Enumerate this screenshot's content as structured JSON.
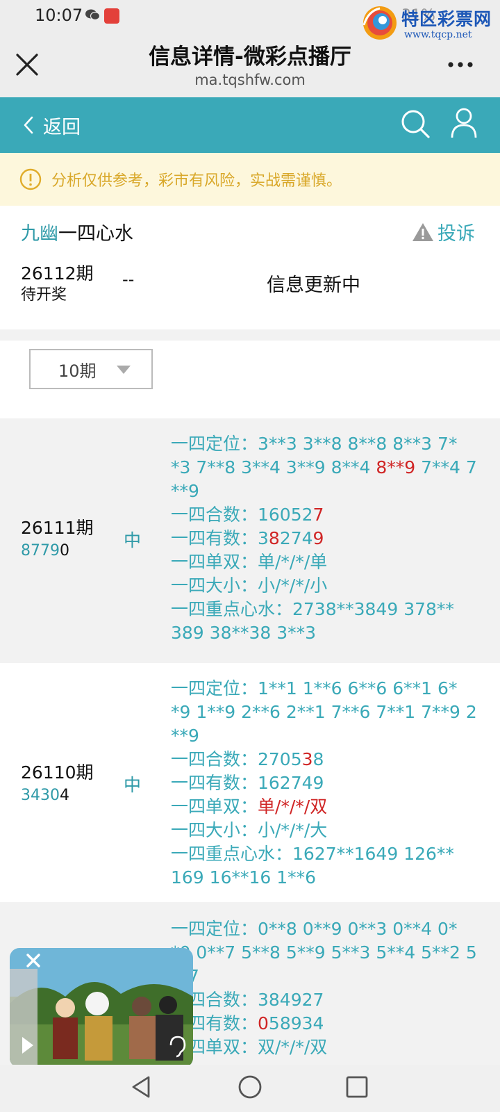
{
  "status": {
    "time": "10:07",
    "battery": "31%"
  },
  "watermark": {
    "name": "特区彩票网",
    "url": "www.tqcp.net"
  },
  "titlebar": {
    "title": "信息详情-微彩点播厅",
    "url": "ma.tqshfw.com"
  },
  "navbar": {
    "back_label": "返回"
  },
  "warning": {
    "text": "分析仅供参考，彩市有风险，实战需谨慎。"
  },
  "info": {
    "author": "九幽",
    "topic": "一四心水",
    "report_label": "投诉",
    "period": "26112期",
    "status": "待开奖",
    "dash": "--",
    "update_text": "信息更新中"
  },
  "filter": {
    "selected": "10期"
  },
  "records": [
    {
      "period": "26111期",
      "num_prefix": "8779",
      "num_last": "0",
      "hit": "中",
      "lines": [
        {
          "segs": [
            {
              "t": "一四定位：3**3 3**8 8**8 8**3 7*"
            }
          ]
        },
        {
          "segs": [
            {
              "t": "*3 7**8 3**4 3**9 8**4 "
            },
            {
              "t": "8**9",
              "r": true
            },
            {
              "t": " 7**4 7"
            }
          ]
        },
        {
          "segs": [
            {
              "t": "**9"
            }
          ]
        },
        {
          "segs": [
            {
              "t": "一四合数：16052"
            },
            {
              "t": "7",
              "r": true
            }
          ]
        },
        {
          "segs": [
            {
              "t": "一四有数：3"
            },
            {
              "t": "8",
              "r": true
            },
            {
              "t": "274"
            },
            {
              "t": "9",
              "r": true
            }
          ]
        },
        {
          "segs": [
            {
              "t": "一四单双：单/*/*/单"
            }
          ]
        },
        {
          "segs": [
            {
              "t": "一四大小：小/*/*/小"
            }
          ]
        },
        {
          "segs": [
            {
              "t": "一四重点心水：2738**3849 378**"
            }
          ]
        },
        {
          "segs": [
            {
              "t": "389 38**38 3**3"
            }
          ]
        }
      ]
    },
    {
      "period": "26110期",
      "num_prefix": "3430",
      "num_last": "4",
      "hit": "中",
      "lines": [
        {
          "segs": [
            {
              "t": "一四定位：1**1 1**6 6**6 6**1 6*"
            }
          ]
        },
        {
          "segs": [
            {
              "t": "*9 1**9 2**6 2**1 7**6 7**1 7**9 2"
            }
          ]
        },
        {
          "segs": [
            {
              "t": "**9"
            }
          ]
        },
        {
          "segs": [
            {
              "t": "一四合数：2705"
            },
            {
              "t": "3",
              "r": true
            },
            {
              "t": "8"
            }
          ]
        },
        {
          "segs": [
            {
              "t": "一四有数：162749"
            }
          ]
        },
        {
          "segs": [
            {
              "t": "一四单双："
            },
            {
              "t": "单/*/*/双",
              "r": true
            }
          ]
        },
        {
          "segs": [
            {
              "t": "一四大小：小/*/*/大"
            }
          ]
        },
        {
          "segs": [
            {
              "t": "一四重点心水：1627**1649 126**"
            }
          ]
        },
        {
          "segs": [
            {
              "t": "169 16**16 1**6"
            }
          ]
        }
      ]
    },
    {
      "period": "",
      "num_prefix": "",
      "num_last": "",
      "hit": "",
      "lines": [
        {
          "segs": [
            {
              "t": "一四定位：0**8 0**9 0**3 0**4 0*"
            }
          ]
        },
        {
          "segs": [
            {
              "t": "*0 0**7 5**8 5**9 5**3 5**4 5**2 5"
            }
          ]
        },
        {
          "segs": [
            {
              "t": "**7"
            }
          ]
        },
        {
          "segs": [
            {
              "t": "一四合数：384927"
            }
          ]
        },
        {
          "segs": [
            {
              "t": "一四有数："
            },
            {
              "t": "0",
              "r": true
            },
            {
              "t": "58934"
            }
          ]
        },
        {
          "segs": [
            {
              "t": "一四单双：双/*/*/双"
            }
          ]
        }
      ]
    }
  ],
  "colors": {
    "teal": "#3aa9b8",
    "red": "#d02525",
    "warn_text": "#d9a82a",
    "warn_bg": "#fdf7dc"
  }
}
